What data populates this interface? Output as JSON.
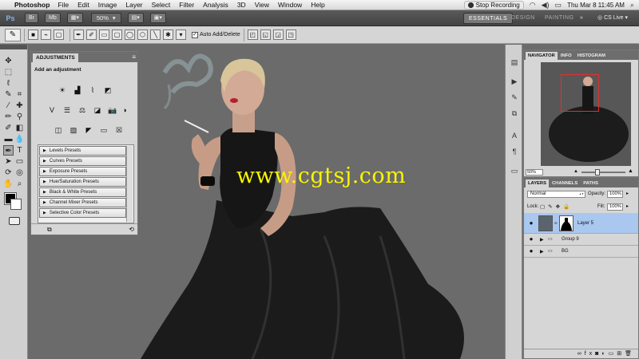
{
  "menubar": {
    "app": "Photoshop",
    "items": [
      "File",
      "Edit",
      "Image",
      "Layer",
      "Select",
      "Filter",
      "Analysis",
      "3D",
      "View",
      "Window",
      "Help"
    ],
    "recording": "Stop Recording",
    "clock": "Thu Mar 8  11:45 AM"
  },
  "appbar": {
    "logo": "Ps",
    "bridge": "Br",
    "minibridge": "Mb",
    "zoom": "50%",
    "workspaces": [
      "ESSENTIALS",
      "DESIGN",
      "PAINTING"
    ],
    "more": "»",
    "cslive": "CS Live"
  },
  "options": {
    "auto_add_delete": "Auto Add/Delete"
  },
  "adjustments": {
    "tab": "ADJUSTMENTS",
    "title": "Add an adjustment",
    "presets": [
      "Levels Presets",
      "Curves Presets",
      "Exposure Presets",
      "Hue/Saturation Presets",
      "Black & White Presets",
      "Channel Mixer Presets",
      "Selective Color Presets"
    ]
  },
  "canvas": {
    "watermark": "www.cgtsj.com"
  },
  "navigator": {
    "tabs": [
      "NAVIGATOR",
      "INFO",
      "HISTOGRAM"
    ],
    "zoom": "50%"
  },
  "layers": {
    "tabs": [
      "LAYERS",
      "CHANNELS",
      "PATHS"
    ],
    "blend_mode": "Normal",
    "opacity_label": "Opacity:",
    "opacity": "100%",
    "lock_label": "Lock:",
    "fill_label": "Fill:",
    "fill": "100%",
    "rows": [
      "Layer 5",
      "Group 9",
      "BG"
    ]
  },
  "colors": {
    "watermark": "#f8f500",
    "selection": "#a9c7ef",
    "navigator_view": "#e03030"
  }
}
